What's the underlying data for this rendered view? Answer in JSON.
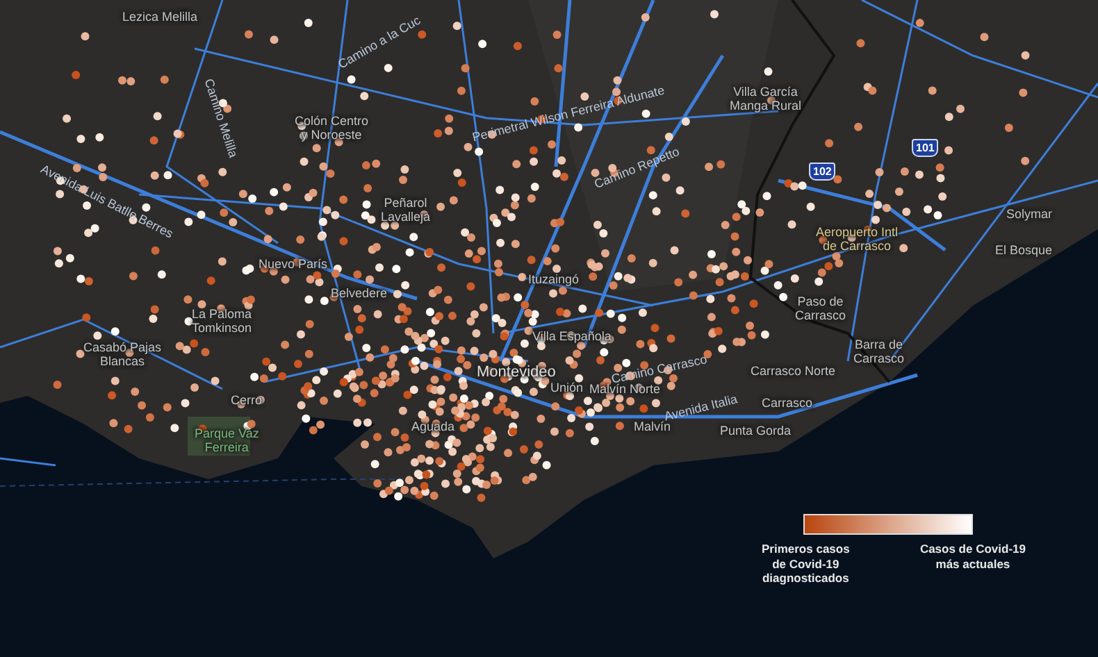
{
  "map": {
    "places": [
      {
        "name": "Lezica Melilla",
        "kind": "place"
      },
      {
        "name": "Colón Centro\ny Noroeste",
        "kind": "place"
      },
      {
        "name": "Peñarol\nLavalleja",
        "kind": "place"
      },
      {
        "name": "Nuevo París",
        "kind": "place"
      },
      {
        "name": "Belvedere",
        "kind": "place"
      },
      {
        "name": "La Paloma\nTomkinson",
        "kind": "place"
      },
      {
        "name": "Casabó Pajas\nBlancas",
        "kind": "place"
      },
      {
        "name": "Cerro",
        "kind": "place"
      },
      {
        "name": "Parque Vaz\nFerreira",
        "kind": "park"
      },
      {
        "name": "Ituzaingó",
        "kind": "place"
      },
      {
        "name": "Villa Española",
        "kind": "place"
      },
      {
        "name": "Montevideo",
        "kind": "city"
      },
      {
        "name": "Unión",
        "kind": "place"
      },
      {
        "name": "Malvín Norte",
        "kind": "place"
      },
      {
        "name": "Aguada",
        "kind": "place"
      },
      {
        "name": "Malvín",
        "kind": "place"
      },
      {
        "name": "Villa García\nManga Rural",
        "kind": "place"
      },
      {
        "name": "Aeropuerto Intl\nde Carrasco",
        "kind": "airport"
      },
      {
        "name": "Paso de\nCarrasco",
        "kind": "place"
      },
      {
        "name": "Barra de\nCarrasco",
        "kind": "place"
      },
      {
        "name": "Carrasco Norte",
        "kind": "place"
      },
      {
        "name": "Carrasco",
        "kind": "place"
      },
      {
        "name": "Punta Gorda",
        "kind": "place"
      },
      {
        "name": "Solymar",
        "kind": "place"
      },
      {
        "name": "El Bosque",
        "kind": "place"
      }
    ],
    "roads": [
      "Avenida Luis Batlle Berres",
      "Camino Melilla",
      "Perimetral Wilson Ferreira Aldunate",
      "Camino Repetto",
      "Camino Carrasco",
      "Avenida Italia",
      "Camino a la Cuc"
    ],
    "shields": [
      "101",
      "102"
    ]
  },
  "legend": {
    "start_label": "Primeros casos\nde Covid-19\ndiagnosticados",
    "end_label": "Casos de Covid-19\nmás actuales"
  }
}
